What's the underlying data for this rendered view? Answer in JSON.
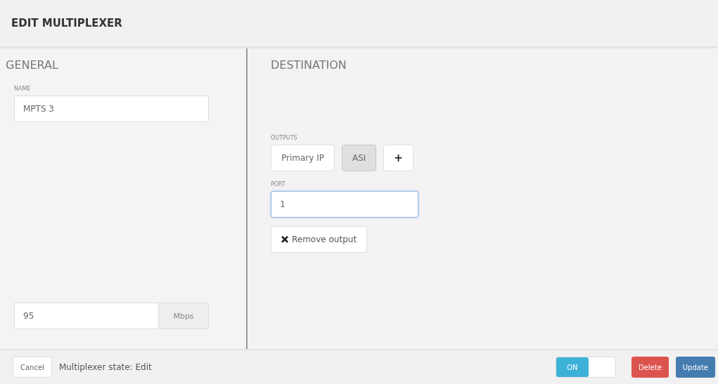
{
  "title": "EDIT MULTIPLEXER",
  "general": {
    "heading": "GENERAL",
    "name_label": "NAME",
    "name_value": "MPTS 3",
    "bitrate_value": "95",
    "bitrate_unit": "Mbps"
  },
  "destination": {
    "heading": "DESTINATION",
    "outputs_label": "OUTPUTS",
    "outputs": [
      {
        "label": "Primary IP",
        "selected": false
      },
      {
        "label": "ASI",
        "selected": true
      }
    ],
    "add_button": "+",
    "port_label": "PORT",
    "port_value": "1",
    "remove_button": "Remove output"
  },
  "footer": {
    "cancel": "Cancel",
    "state_text": "Multiplexer state: Edit",
    "toggle": {
      "label": "ON",
      "on": true
    },
    "delete": "Delete",
    "update": "Update"
  }
}
